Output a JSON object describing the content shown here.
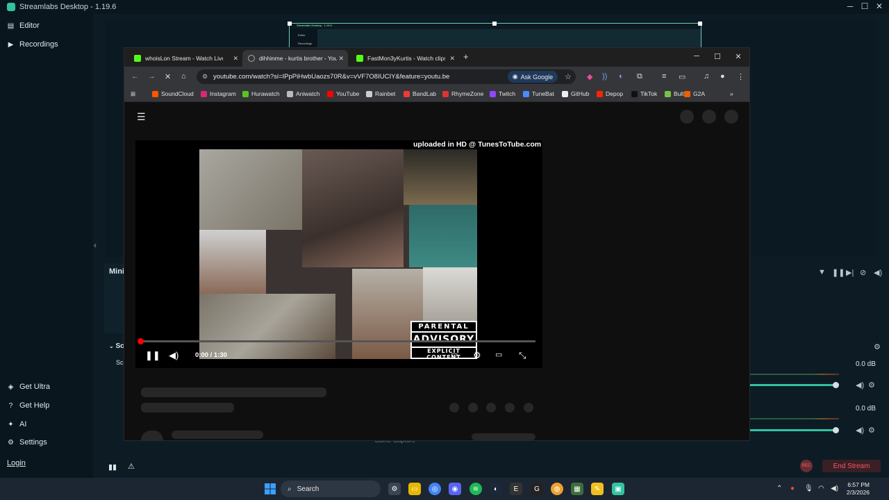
{
  "app": {
    "title": "Streamlabs Desktop - 1.19.6",
    "sidebar_top": [
      {
        "label": "Editor"
      },
      {
        "label": "Recordings"
      }
    ],
    "sidebar_bottom": [
      {
        "label": "Get Ultra"
      },
      {
        "label": "Get Help"
      },
      {
        "label": "AI"
      },
      {
        "label": "Settings"
      }
    ],
    "login_label": "Login",
    "mini_label": "Mini",
    "scenes_label": "Sc",
    "scenes_label2": "Sc",
    "mixer": [
      {
        "db": "0.0 dB",
        "level": 0.92
      },
      {
        "db": "0.0 dB",
        "level": 0.92
      }
    ],
    "end_stream_label": "End Stream",
    "rec_label": "REC",
    "source_item_partial": "Game Capture",
    "nested_title": "Streamlabs Desktop - 1.19.6",
    "nested_items": [
      "Editor",
      "Recordings"
    ]
  },
  "browser": {
    "tabs": [
      {
        "title": "whoisLon Stream - Watch Live",
        "favicon_color": "#53fc18",
        "active": false
      },
      {
        "title": "dihhinme - kurtis brother - You",
        "favicon_color": "#8a8a8a",
        "active": true
      },
      {
        "title": "FastMon3yKurtis - Watch clips",
        "favicon_color": "#53fc18",
        "active": false
      }
    ],
    "url": "youtube.com/watch?si=IPpPiHwbUaozs70R&v=vVF7O8IUCIY&feature=youtu.be",
    "ask_google_label": "Ask Google",
    "bookmarks": [
      {
        "label": "SoundCloud",
        "color": "#ff5500"
      },
      {
        "label": "Instagram",
        "color": "#d62976"
      },
      {
        "label": "Hurawatch",
        "color": "#58c322"
      },
      {
        "label": "Aniwatch",
        "color": "#bbbbbb"
      },
      {
        "label": "YouTube",
        "color": "#ff0000"
      },
      {
        "label": "Rainbet",
        "color": "#cccccc"
      },
      {
        "label": "BandLab",
        "color": "#f2383a"
      },
      {
        "label": "RhymeZone",
        "color": "#d33"
      },
      {
        "label": "Twitch",
        "color": "#9146ff"
      },
      {
        "label": "TuneBat",
        "color": "#4a8cff"
      },
      {
        "label": "GitHub",
        "color": "#eeeeee"
      },
      {
        "label": "Depop",
        "color": "#ff2300"
      },
      {
        "label": "TikTok",
        "color": "#111111"
      },
      {
        "label": "Bullx",
        "color": "#7ac143"
      },
      {
        "label": "G2A",
        "color": "#f05f00"
      }
    ]
  },
  "video": {
    "watermark": "uploaded in HD @ TunesToTube.com",
    "time": "0:00 / 1:30",
    "progress": 0.0,
    "advisory_line1": "PARENTAL",
    "advisory_line2": "ADVISORY",
    "advisory_line3": "EXPLICIT CONTENT"
  },
  "taskbar": {
    "search_label": "Search",
    "time": "6:57 PM",
    "date": "2/3/2026"
  }
}
